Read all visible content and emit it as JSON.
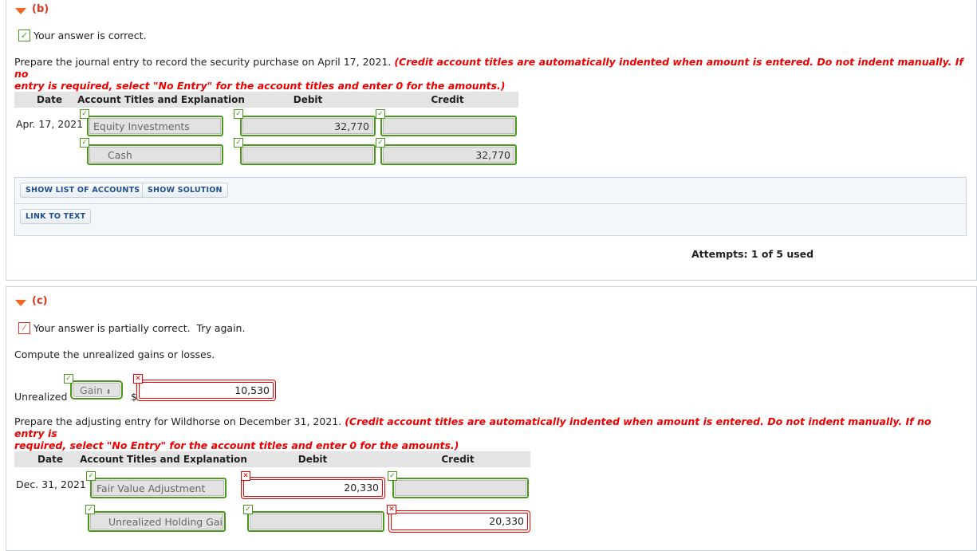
{
  "part_b": {
    "label": "(b)",
    "status": "Your answer is correct.",
    "instruction": "Prepare the journal entry to record the security purchase on April 17, 2021.",
    "instruction_note_line1": "(Credit account titles are automatically indented when amount is entered. Do not indent manually. If no",
    "instruction_note_line2": "entry is required, select \"No Entry\" for the account titles and enter 0 for the amounts.)",
    "headers": {
      "date": "Date",
      "account": "Account Titles and Explanation",
      "debit": "Debit",
      "credit": "Credit"
    },
    "rows": [
      {
        "date": "Apr. 17, 2021",
        "account": "Equity Investments",
        "debit": "32,770",
        "credit": ""
      },
      {
        "date": "",
        "account": "Cash",
        "debit": "",
        "credit": "32,770"
      }
    ],
    "buttons": {
      "show_accounts": "SHOW LIST OF ACCOUNTS",
      "show_solution": "SHOW SOLUTION",
      "link_to_text": "LINK TO TEXT"
    },
    "attempts": "Attempts: 1 of 5 used"
  },
  "part_c": {
    "label": "(c)",
    "status": "Your answer is partially correct.  Try again.",
    "compute_prompt": "Compute the unrealized gains or losses.",
    "unrealized_label": "Unrealized",
    "gain_select": "Gain",
    "currency": "$",
    "unrealized_amount": "10,530",
    "instruction": "Prepare the adjusting entry for Wildhorse on December 31, 2021.",
    "instruction_note_line1": "(Credit account titles are automatically indented when amount is entered. Do not indent manually. If no entry is",
    "instruction_note_line2": "required, select \"No Entry\" for the account titles and enter 0 for the amounts.)",
    "headers": {
      "date": "Date",
      "account": "Account Titles and Explanation",
      "debit": "Debit",
      "credit": "Credit"
    },
    "rows": [
      {
        "date": "Dec. 31, 2021",
        "account": "Fair Value Adjustment",
        "debit": "20,330",
        "credit": ""
      },
      {
        "date": "",
        "account": "Unrealized Holding Gair",
        "debit": "",
        "credit": "20,330"
      }
    ]
  },
  "colors": {
    "correct": "#4a9a1a",
    "incorrect": "#e00000",
    "accent": "#f26522",
    "button_text": "#1d4f91"
  }
}
